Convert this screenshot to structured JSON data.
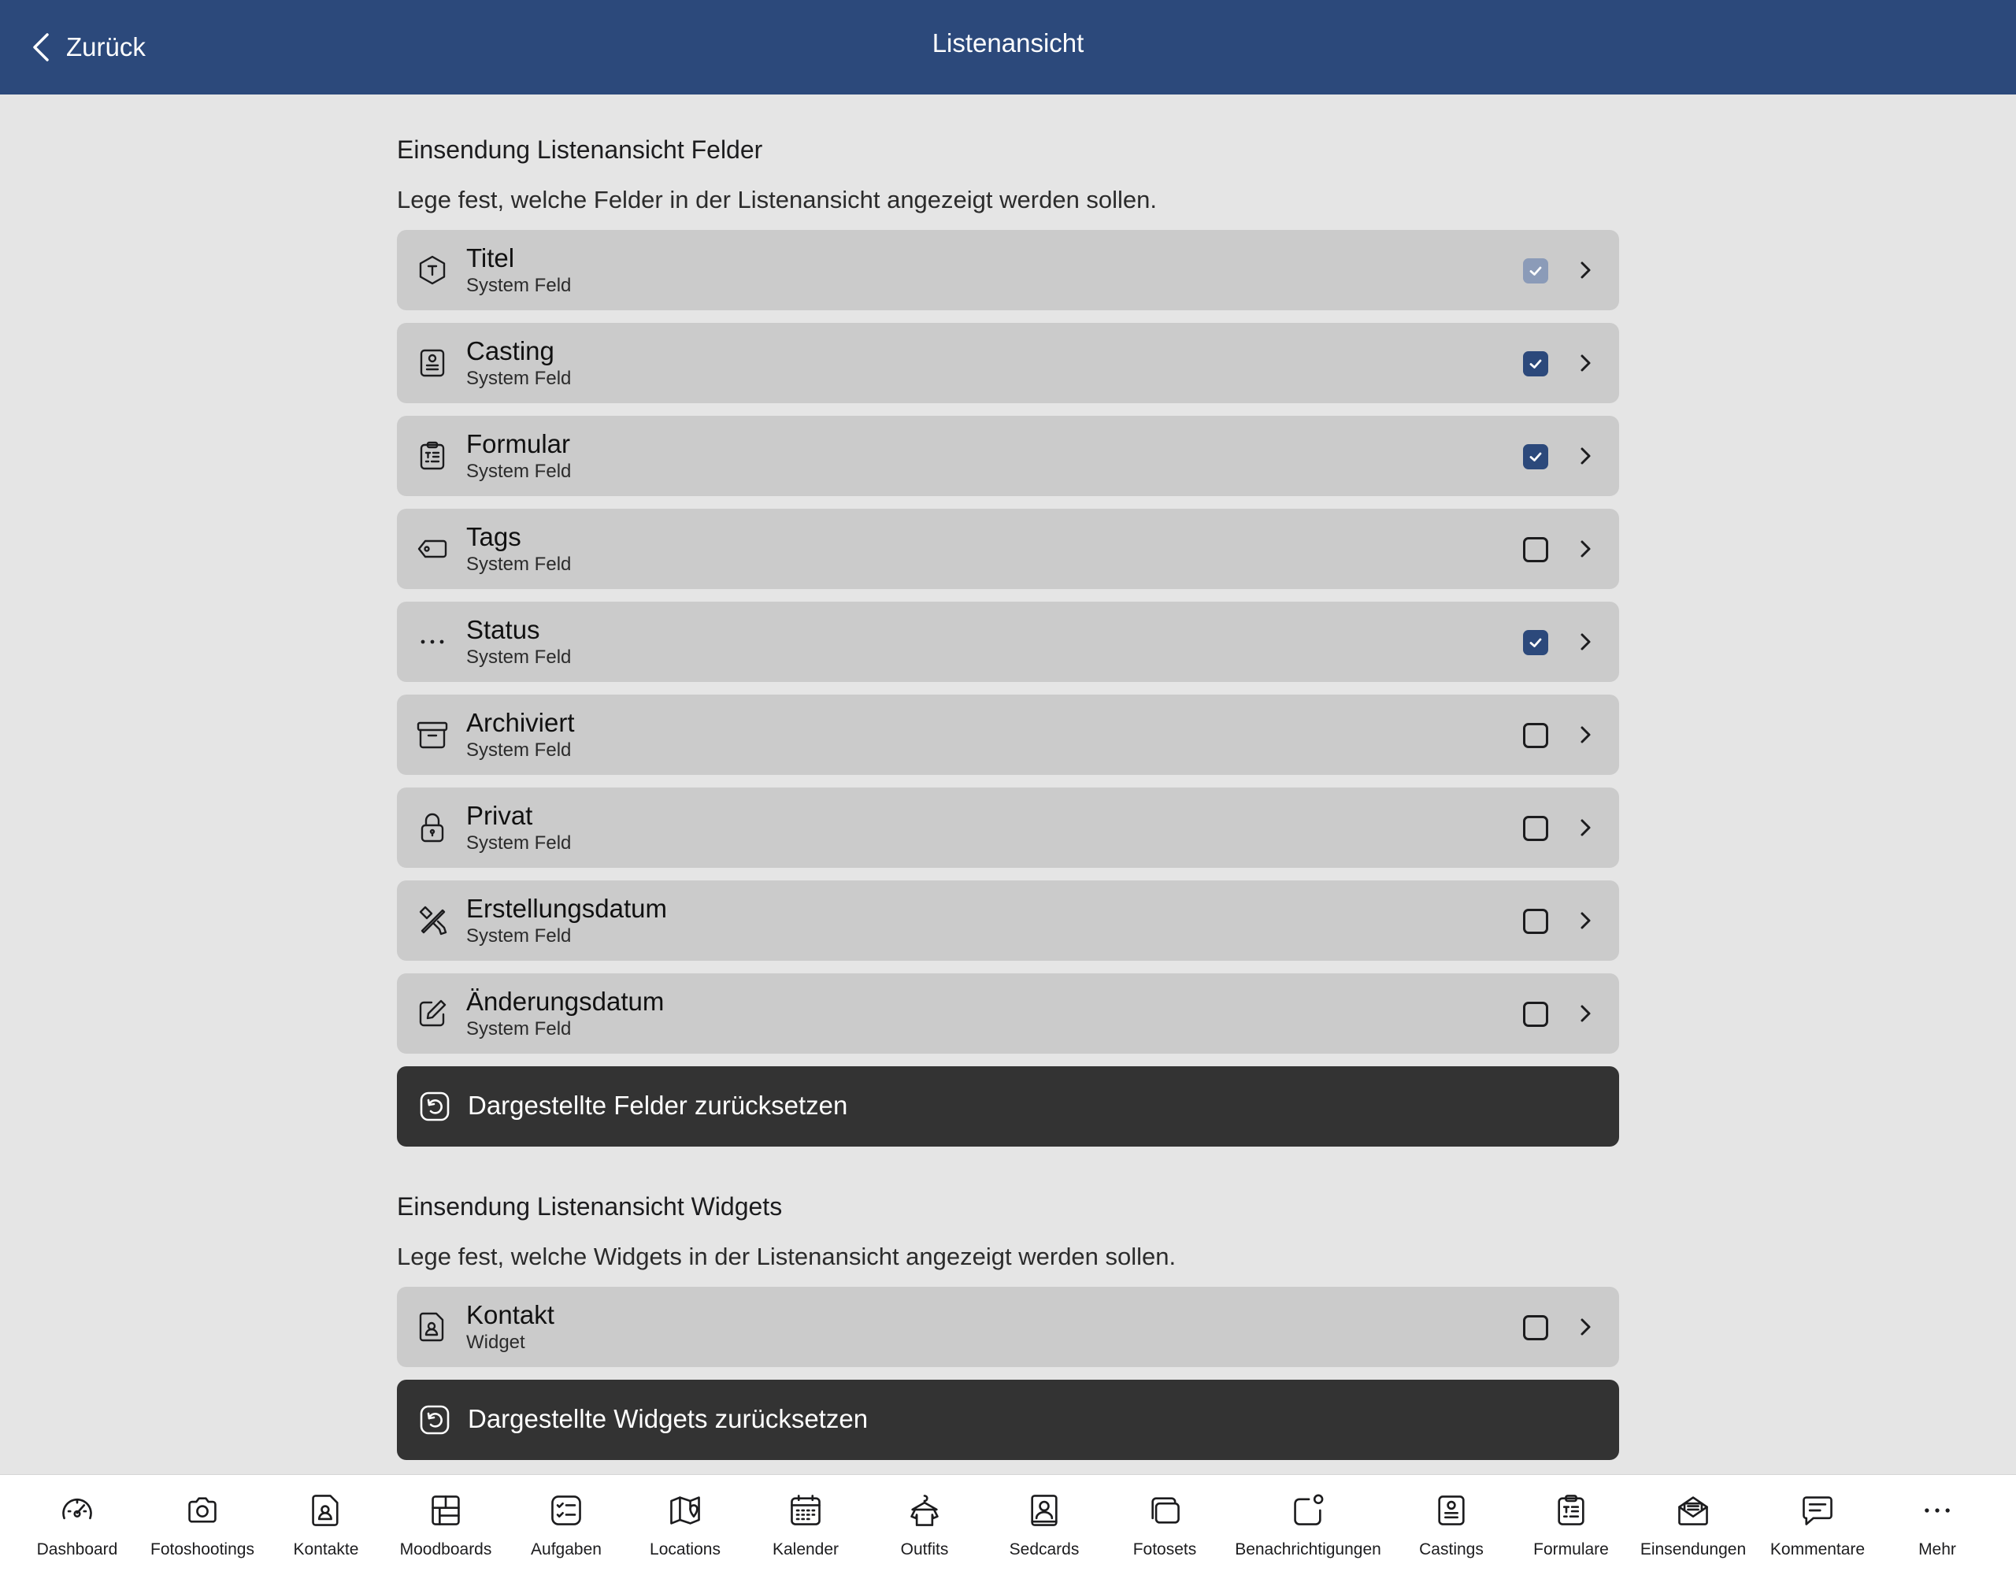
{
  "header": {
    "back_label": "Zurück",
    "title": "Listenansicht"
  },
  "fields_section": {
    "title": "Einsendung Listenansicht Felder",
    "description": "Lege fest, welche Felder in der Listenansicht angezeigt werden sollen.",
    "items": [
      {
        "label": "Titel",
        "sublabel": "System Feld",
        "icon": "title-hexagon-icon",
        "state": "checked-disabled"
      },
      {
        "label": "Casting",
        "sublabel": "System Feld",
        "icon": "casting-card-icon",
        "state": "checked"
      },
      {
        "label": "Formular",
        "sublabel": "System Feld",
        "icon": "form-clipboard-icon",
        "state": "checked"
      },
      {
        "label": "Tags",
        "sublabel": "System Feld",
        "icon": "tag-icon",
        "state": "unchecked"
      },
      {
        "label": "Status",
        "sublabel": "System Feld",
        "icon": "ellipsis-icon",
        "state": "checked"
      },
      {
        "label": "Archiviert",
        "sublabel": "System Feld",
        "icon": "archive-box-icon",
        "state": "unchecked"
      },
      {
        "label": "Privat",
        "sublabel": "System Feld",
        "icon": "lock-icon",
        "state": "unchecked"
      },
      {
        "label": "Erstellungsdatum",
        "sublabel": "System Feld",
        "icon": "tools-icon",
        "state": "unchecked"
      },
      {
        "label": "Änderungsdatum",
        "sublabel": "System Feld",
        "icon": "edit-icon",
        "state": "unchecked"
      }
    ],
    "reset_label": "Dargestellte Felder zurücksetzen"
  },
  "widgets_section": {
    "title": "Einsendung Listenansicht Widgets",
    "description": "Lege fest, welche Widgets in der Listenansicht angezeigt werden sollen.",
    "items": [
      {
        "label": "Kontakt",
        "sublabel": "Widget",
        "icon": "contact-file-icon",
        "state": "unchecked"
      }
    ],
    "reset_label": "Dargestellte Widgets zurücksetzen"
  },
  "tabbar": [
    {
      "label": "Dashboard",
      "icon": "gauge-icon"
    },
    {
      "label": "Fotoshootings",
      "icon": "camera-icon"
    },
    {
      "label": "Kontakte",
      "icon": "contact-file-icon"
    },
    {
      "label": "Moodboards",
      "icon": "moodboard-grid-icon"
    },
    {
      "label": "Aufgaben",
      "icon": "tasks-icon"
    },
    {
      "label": "Locations",
      "icon": "map-pin-icon"
    },
    {
      "label": "Kalender",
      "icon": "calendar-icon"
    },
    {
      "label": "Outfits",
      "icon": "hanger-shirt-icon"
    },
    {
      "label": "Sedcards",
      "icon": "sedcard-icon"
    },
    {
      "label": "Fotosets",
      "icon": "photo-stack-icon"
    },
    {
      "label": "Benachrichtigungen",
      "icon": "notification-icon"
    },
    {
      "label": "Castings",
      "icon": "casting-card-icon"
    },
    {
      "label": "Formulare",
      "icon": "form-clipboard-icon"
    },
    {
      "label": "Einsendungen",
      "icon": "envelope-open-icon"
    },
    {
      "label": "Kommentare",
      "icon": "comment-icon"
    },
    {
      "label": "Mehr",
      "icon": "more-icon"
    }
  ],
  "colors": {
    "header": "#2c497b",
    "checkbox_checked": "#2c497b",
    "checkbox_disabled": "#8b9bb8",
    "action_bg": "#333333",
    "row_bg": "#cbcbcb",
    "page_bg": "#e5e5e5"
  }
}
